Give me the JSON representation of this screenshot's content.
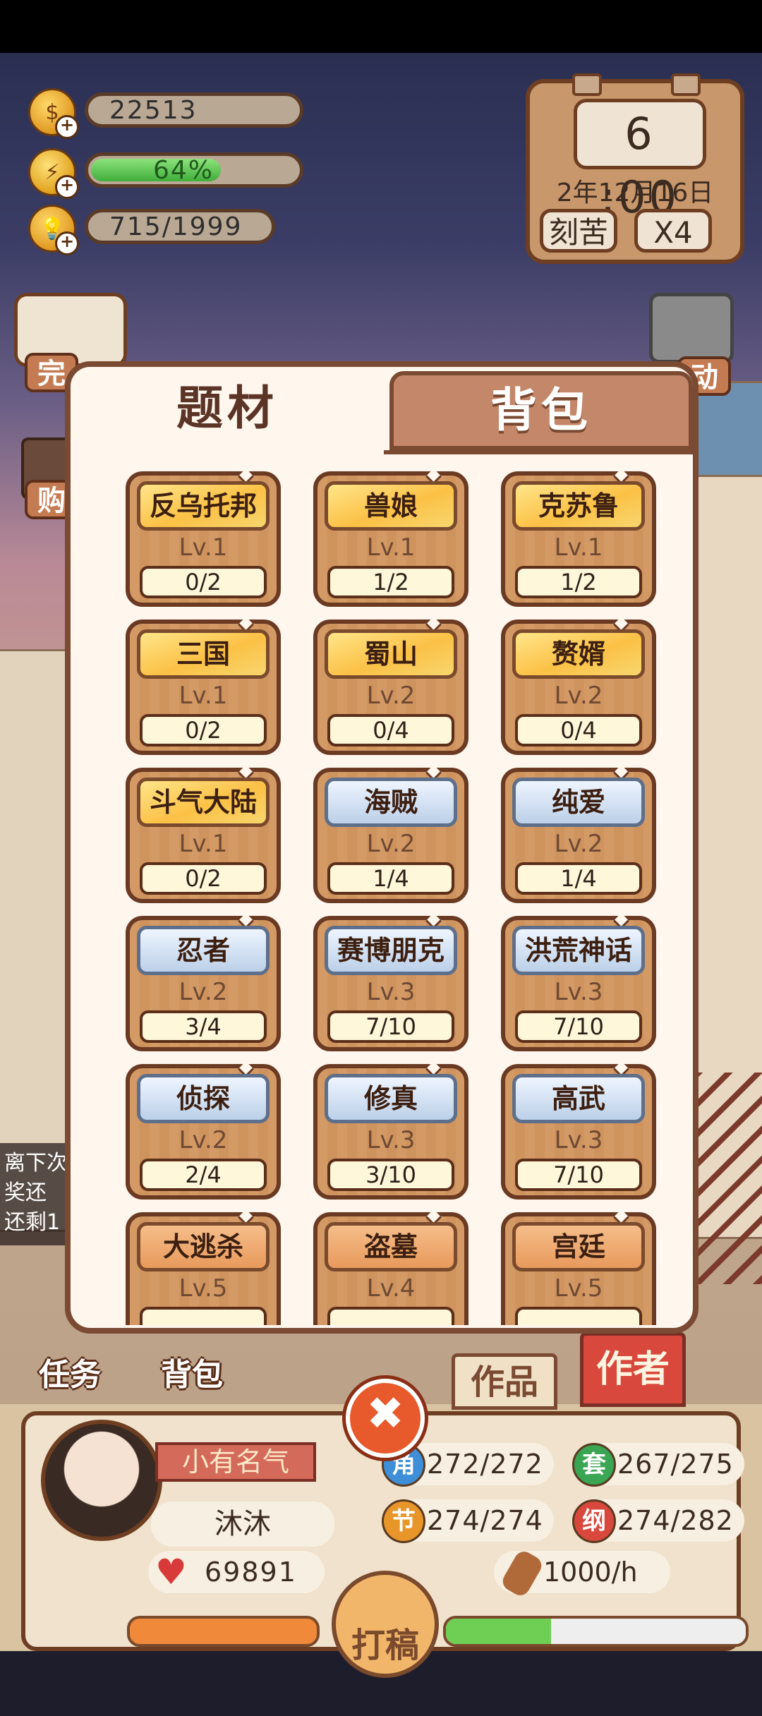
{
  "hud": {
    "coins": "22513",
    "energy_text": "64%",
    "energy_fraction": 0.64,
    "ideas": "715/1999"
  },
  "clock": {
    "time": "6 :00",
    "date": "2年12月16日",
    "mode_button": "刻苦",
    "speed_button": "X4"
  },
  "side": {
    "left_label_1": "完",
    "left_label_2": "购",
    "right_label_1": "动"
  },
  "offline_note": [
    "离下次",
    "奖还",
    "还剩1"
  ],
  "modal": {
    "tab_active": "题材",
    "tab_inactive": "背包",
    "cards": [
      {
        "name": "反乌托邦",
        "lv": "Lv.1",
        "progress": "0/2",
        "style": "gold"
      },
      {
        "name": "兽娘",
        "lv": "Lv.1",
        "progress": "1/2",
        "style": "gold"
      },
      {
        "name": "克苏鲁",
        "lv": "Lv.1",
        "progress": "1/2",
        "style": "gold"
      },
      {
        "name": "三国",
        "lv": "Lv.1",
        "progress": "0/2",
        "style": "gold"
      },
      {
        "name": "蜀山",
        "lv": "Lv.2",
        "progress": "0/4",
        "style": "gold"
      },
      {
        "name": "赘婿",
        "lv": "Lv.2",
        "progress": "0/4",
        "style": "gold"
      },
      {
        "name": "斗气大陆",
        "lv": "Lv.1",
        "progress": "0/2",
        "style": "gold"
      },
      {
        "name": "海贼",
        "lv": "Lv.2",
        "progress": "1/4",
        "style": "blue"
      },
      {
        "name": "纯爱",
        "lv": "Lv.2",
        "progress": "1/4",
        "style": "blue"
      },
      {
        "name": "忍者",
        "lv": "Lv.2",
        "progress": "3/4",
        "style": "blue"
      },
      {
        "name": "赛博朋克",
        "lv": "Lv.3",
        "progress": "7/10",
        "style": "blue"
      },
      {
        "name": "洪荒神话",
        "lv": "Lv.3",
        "progress": "7/10",
        "style": "blue"
      },
      {
        "name": "侦探",
        "lv": "Lv.2",
        "progress": "2/4",
        "style": "blue"
      },
      {
        "name": "修真",
        "lv": "Lv.3",
        "progress": "3/10",
        "style": "blue"
      },
      {
        "name": "高武",
        "lv": "Lv.3",
        "progress": "7/10",
        "style": "blue"
      },
      {
        "name": "大逃杀",
        "lv": "Lv.5",
        "progress": "",
        "style": "orange"
      },
      {
        "name": "盗墓",
        "lv": "Lv.4",
        "progress": "",
        "style": "orange"
      },
      {
        "name": "宫廷",
        "lv": "Lv.5",
        "progress": "",
        "style": "orange"
      }
    ]
  },
  "bottom": {
    "task_label": "任务",
    "bag_label": "背包",
    "works_tag": "作品",
    "author_tag": "作者",
    "close_glyph": "✖",
    "title_badge": "小有名气",
    "player_name": "沐沐",
    "likes": "69891",
    "stats": [
      {
        "icon": "角",
        "value": "272/272",
        "color": "#3f8fd8"
      },
      {
        "icon": "套",
        "value": "267/275",
        "color": "#3aa552"
      },
      {
        "icon": "节",
        "value": "274/274",
        "color": "#e8962a"
      },
      {
        "icon": "纲",
        "value": "274/282",
        "color": "#d8483c"
      }
    ],
    "rate": "1000/h",
    "draft_button": "打稿",
    "draft_progress_fraction": 0.35
  }
}
